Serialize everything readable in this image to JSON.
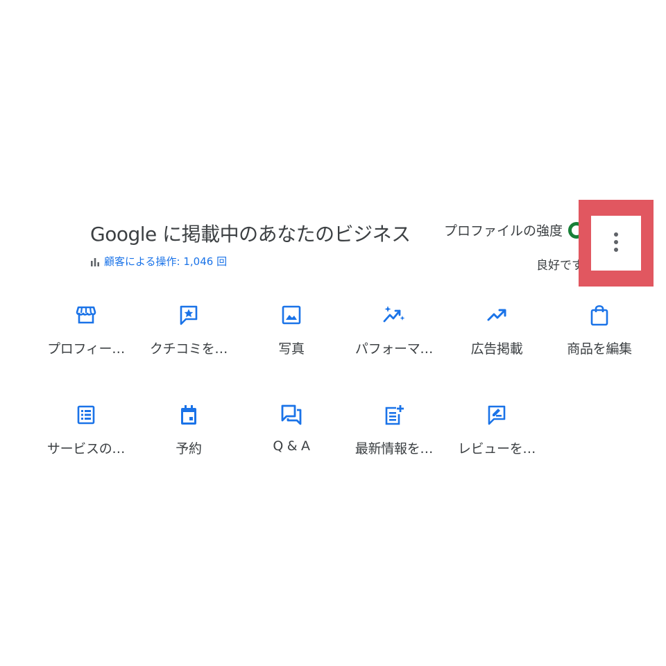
{
  "header": {
    "title": "Google に掲載中のあなたのビジネス",
    "interactions_label": "顧客による操作: 1,046 回",
    "interactions_icon": "bar-chart-icon"
  },
  "profile_strength": {
    "label": "プロファイルの強度",
    "status": "良好です",
    "ring_color": "#188038"
  },
  "more_menu": {
    "icon": "more-vert-icon",
    "highlight_color": "#e15760"
  },
  "accent_color": "#1a73e8",
  "actions": [
    {
      "label": "プロフィー…",
      "icon": "storefront-icon"
    },
    {
      "label": "クチコミを…",
      "icon": "review-star-icon"
    },
    {
      "label": "写真",
      "icon": "photo-icon"
    },
    {
      "label": "パフォーマ…",
      "icon": "sparkle-trend-icon"
    },
    {
      "label": "広告掲載",
      "icon": "trending-up-icon"
    },
    {
      "label": "商品を編集",
      "icon": "shopping-bag-icon"
    },
    {
      "label": "サービスの…",
      "icon": "list-alt-icon"
    },
    {
      "label": "予約",
      "icon": "calendar-icon"
    },
    {
      "label": "Q & A",
      "icon": "forum-icon"
    },
    {
      "label": "最新情報を…",
      "icon": "post-add-icon"
    },
    {
      "label": "レビューを…",
      "icon": "rate-review-icon"
    }
  ]
}
